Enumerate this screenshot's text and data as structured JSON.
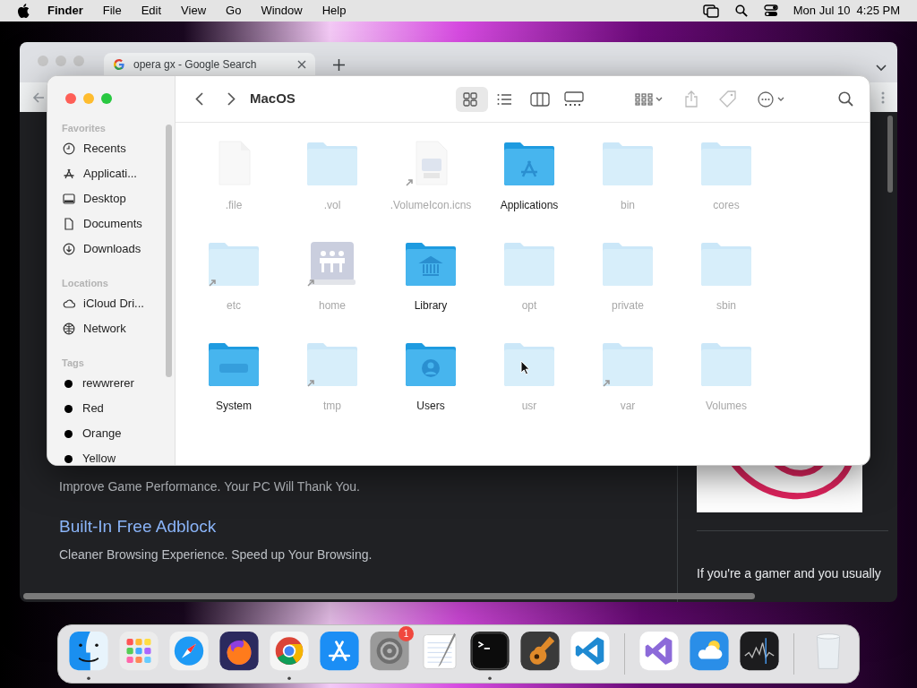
{
  "menubar": {
    "app": "Finder",
    "menus": [
      "File",
      "Edit",
      "View",
      "Go",
      "Window",
      "Help"
    ],
    "clock": "Mon Jul 10  4:25 PM"
  },
  "browser": {
    "tab": "opera gx - Google Search",
    "results": [
      {
        "snippet": "Improve Game Performance. Your PC Will Thank You."
      },
      {
        "title": "Built-In Free Adblock",
        "snippet": "Cleaner Browsing Experience. Speed up Your Browsing."
      }
    ],
    "side_text": "If you're a gamer and you usually"
  },
  "finder": {
    "title": "MacOS",
    "views": [
      {
        "kind": "icons",
        "selected": true
      },
      {
        "kind": "list",
        "selected": false
      },
      {
        "kind": "columns",
        "selected": false
      },
      {
        "kind": "gallery",
        "selected": false
      }
    ],
    "sidebar": [
      {
        "heading": "Favorites",
        "items": [
          {
            "label": "Recents"
          },
          {
            "label": "Applicati..."
          },
          {
            "label": "Desktop"
          },
          {
            "label": "Documents"
          },
          {
            "label": "Downloads"
          }
        ]
      },
      {
        "heading": "Locations",
        "items": [
          {
            "label": "iCloud Dri..."
          },
          {
            "label": "Network"
          }
        ]
      },
      {
        "heading": "Tags",
        "items": [
          {
            "label": "rewwrerer",
            "color": "#000000"
          },
          {
            "label": "Red",
            "color": "#000000"
          },
          {
            "label": "Orange",
            "color": "#000000"
          },
          {
            "label": "Yellow",
            "color": "#000000"
          }
        ]
      }
    ],
    "items": [
      {
        "name": ".file",
        "kind": "file",
        "hidden": true,
        "alias": false
      },
      {
        "name": ".vol",
        "kind": "folder",
        "hidden": true,
        "alias": false
      },
      {
        "name": ".VolumeIcon.icns",
        "kind": "icns",
        "hidden": true,
        "alias": true
      },
      {
        "name": "Applications",
        "kind": "apps-folder",
        "hidden": false,
        "alias": false
      },
      {
        "name": "bin",
        "kind": "folder",
        "hidden": true,
        "alias": false
      },
      {
        "name": "cores",
        "kind": "folder",
        "hidden": true,
        "alias": false
      },
      {
        "name": "etc",
        "kind": "folder",
        "hidden": true,
        "alias": true
      },
      {
        "name": "home",
        "kind": "drive",
        "hidden": true,
        "alias": true
      },
      {
        "name": "Library",
        "kind": "library-folder",
        "hidden": false,
        "alias": false
      },
      {
        "name": "opt",
        "kind": "folder",
        "hidden": true,
        "alias": false
      },
      {
        "name": "private",
        "kind": "folder",
        "hidden": true,
        "alias": false
      },
      {
        "name": "sbin",
        "kind": "folder",
        "hidden": true,
        "alias": false
      },
      {
        "name": "System",
        "kind": "system-folder",
        "hidden": false,
        "alias": false
      },
      {
        "name": "tmp",
        "kind": "folder",
        "hidden": true,
        "alias": true
      },
      {
        "name": "Users",
        "kind": "users-folder",
        "hidden": false,
        "alias": false
      },
      {
        "name": "usr",
        "kind": "folder",
        "hidden": true,
        "alias": false
      },
      {
        "name": "var",
        "kind": "folder",
        "hidden": true,
        "alias": true
      },
      {
        "name": "Volumes",
        "kind": "folder",
        "hidden": true,
        "alias": false
      }
    ]
  },
  "dock": [
    {
      "kind": "finder",
      "running": true
    },
    {
      "kind": "launchpad",
      "running": false
    },
    {
      "kind": "compass",
      "running": false
    },
    {
      "kind": "fox",
      "running": false
    },
    {
      "kind": "chrome",
      "running": true
    },
    {
      "kind": "appstore",
      "running": false
    },
    {
      "kind": "settings",
      "running": false,
      "badge": "1"
    },
    {
      "kind": "notepad",
      "running": false
    },
    {
      "kind": "terminal",
      "running": true
    },
    {
      "kind": "guitar",
      "running": false
    },
    {
      "kind": "vscode",
      "running": false
    },
    {
      "kind": "separator"
    },
    {
      "kind": "vs",
      "running": false
    },
    {
      "kind": "weather",
      "running": false
    },
    {
      "kind": "stocks",
      "running": false
    },
    {
      "kind": "separator"
    },
    {
      "kind": "trash",
      "running": false
    }
  ]
}
